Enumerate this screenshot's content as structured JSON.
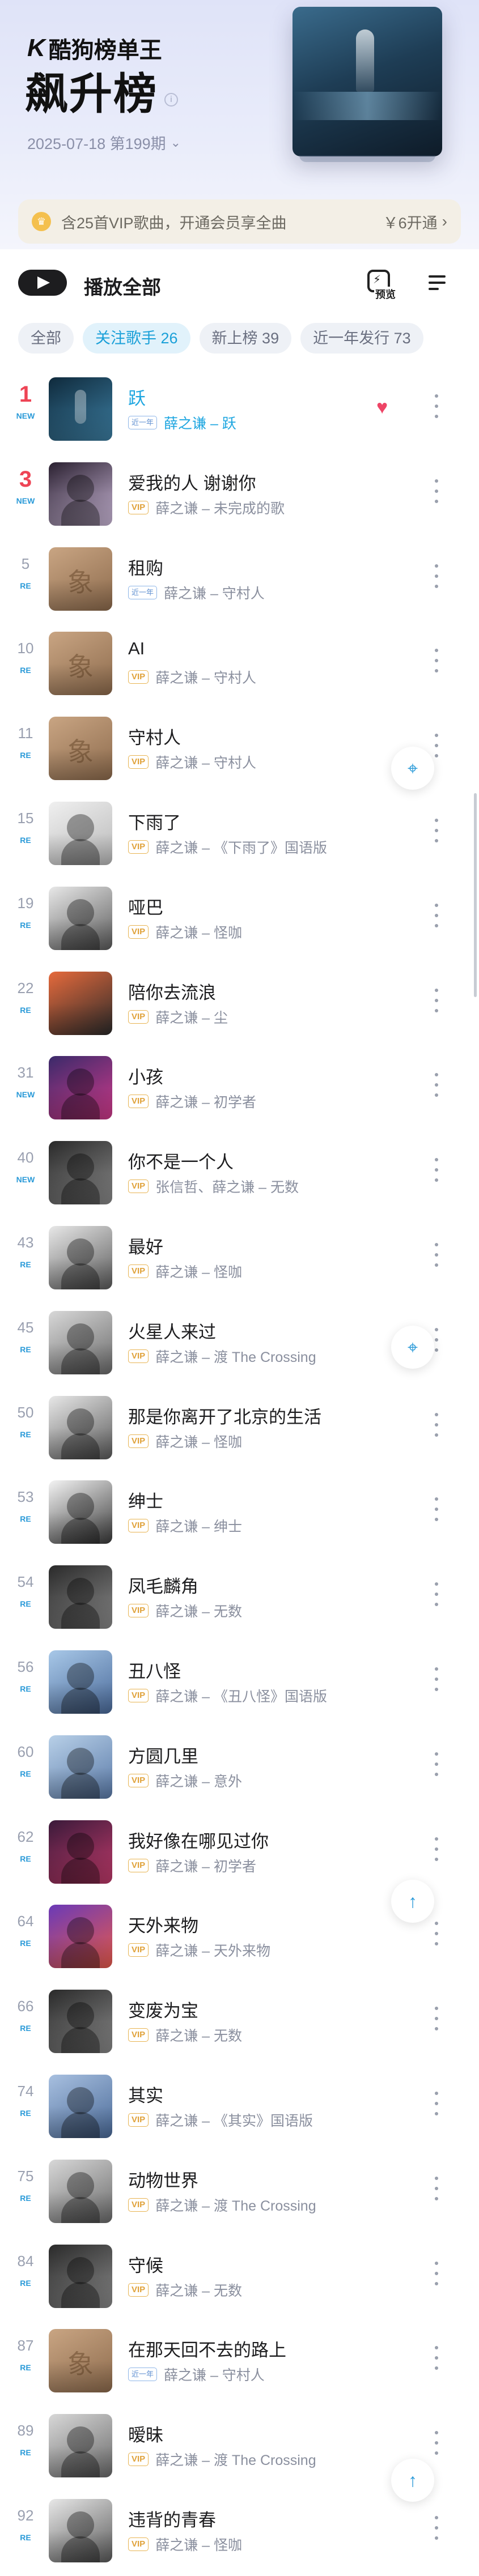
{
  "header": {
    "brand_mark": "K",
    "brand_name": "酷狗榜单王",
    "title": "飙升榜",
    "info_icon": "i",
    "period": "2025-07-18 第199期",
    "period_icon": "chevron-down-icon"
  },
  "vip_banner": {
    "text": "含25首VIP歌曲，开通会员享全曲",
    "price": "￥6开通",
    "icon": "crown-icon"
  },
  "actions": {
    "play_all": "播放全部",
    "preview": "预览"
  },
  "filters": [
    {
      "label": "全部",
      "active": false
    },
    {
      "label": "关注歌手 26",
      "active": true
    },
    {
      "label": "新上榜 39",
      "active": false
    },
    {
      "label": "近一年发行 73",
      "active": false
    }
  ],
  "songs": [
    {
      "rank": "1",
      "trend": "NEW",
      "title": "跃",
      "meta": "薛之谦 – 跃",
      "badge": "first",
      "badge_text": "近一年",
      "current": true,
      "liked": true,
      "art": [
        "#0f2a3c",
        "#3d7fa3"
      ],
      "art_kind": "wave"
    },
    {
      "rank": "3",
      "trend": "NEW",
      "title": "爱我的人 谢谢你",
      "meta": "薛之谦 – 未完成的歌",
      "badge": "vip",
      "badge_text": "VIP",
      "art": [
        "#2a2030",
        "#cbb8d8"
      ],
      "art_kind": "person"
    },
    {
      "rank": "5",
      "trend": "RE",
      "title": "租购",
      "meta": "薛之谦 – 守村人",
      "badge": "first",
      "badge_text": "近一年",
      "art": [
        "#c9a583",
        "#8c6a4c"
      ],
      "art_kind": "glyph"
    },
    {
      "rank": "10",
      "trend": "RE",
      "title": "AI",
      "meta": "薛之谦 – 守村人",
      "badge": "vip",
      "badge_text": "VIP",
      "art": [
        "#c9a583",
        "#8c6a4c"
      ],
      "art_kind": "glyph"
    },
    {
      "rank": "11",
      "trend": "RE",
      "title": "守村人",
      "meta": "薛之谦 – 守村人",
      "badge": "vip",
      "badge_text": "VIP",
      "art": [
        "#c9a583",
        "#8c6a4c"
      ],
      "art_kind": "glyph"
    },
    {
      "rank": "15",
      "trend": "RE",
      "title": "下雨了",
      "meta": "薛之谦 – 《下雨了》国语版",
      "badge": "vip",
      "badge_text": "VIP",
      "art": [
        "#f0f0f0",
        "#b8b8b8"
      ],
      "art_kind": "person"
    },
    {
      "rank": "19",
      "trend": "RE",
      "title": "哑巴",
      "meta": "薛之谦 – 怪咖",
      "badge": "vip",
      "badge_text": "VIP",
      "art": [
        "#e8e8e8",
        "#5a5a5a"
      ],
      "art_kind": "person"
    },
    {
      "rank": "22",
      "trend": "RE",
      "title": "陪你去流浪",
      "meta": "薛之谦 – 尘",
      "badge": "vip",
      "badge_text": "VIP",
      "art": [
        "#e66a3c",
        "#2a2a2a"
      ],
      "art_kind": "none"
    },
    {
      "rank": "31",
      "trend": "NEW",
      "title": "小孩",
      "meta": "薛之谦 – 初学者",
      "badge": "vip",
      "badge_text": "VIP",
      "art": [
        "#3a2a6a",
        "#d03a8a"
      ],
      "art_kind": "person"
    },
    {
      "rank": "40",
      "trend": "NEW",
      "title": "你不是一个人",
      "meta": "张信哲、薛之谦 – 无数",
      "badge": "vip",
      "badge_text": "VIP",
      "art": [
        "#2a2a2a",
        "#8a8a8a"
      ],
      "art_kind": "person"
    },
    {
      "rank": "43",
      "trend": "RE",
      "title": "最好",
      "meta": "薛之谦 – 怪咖",
      "badge": "vip",
      "badge_text": "VIP",
      "art": [
        "#e8e8e8",
        "#5a5a5a"
      ],
      "art_kind": "person"
    },
    {
      "rank": "45",
      "trend": "RE",
      "title": "火星人来过",
      "meta": "薛之谦 – 渡 The Crossing",
      "badge": "vip",
      "badge_text": "VIP",
      "art": [
        "#d8d8d8",
        "#6a6a6a"
      ],
      "art_kind": "person"
    },
    {
      "rank": "50",
      "trend": "RE",
      "title": "那是你离开了北京的生活",
      "meta": "薛之谦 – 怪咖",
      "badge": "vip",
      "badge_text": "VIP",
      "art": [
        "#e8e8e8",
        "#5a5a5a"
      ],
      "art_kind": "person"
    },
    {
      "rank": "53",
      "trend": "RE",
      "title": "绅士",
      "meta": "薛之谦 – 绅士",
      "badge": "vip",
      "badge_text": "VIP",
      "art": [
        "#f4f4f4",
        "#3a3a3a"
      ],
      "art_kind": "person"
    },
    {
      "rank": "54",
      "trend": "RE",
      "title": "凤毛麟角",
      "meta": "薛之谦 – 无数",
      "badge": "vip",
      "badge_text": "VIP",
      "art": [
        "#2a2a2a",
        "#8a8a8a"
      ],
      "art_kind": "person"
    },
    {
      "rank": "56",
      "trend": "RE",
      "title": "丑八怪",
      "meta": "薛之谦 – 《丑八怪》国语版",
      "badge": "vip",
      "badge_text": "VIP",
      "art": [
        "#a8c8e8",
        "#4a6a9a"
      ],
      "art_kind": "person"
    },
    {
      "rank": "60",
      "trend": "RE",
      "title": "方圆几里",
      "meta": "薛之谦 – 意外",
      "badge": "vip",
      "badge_text": "VIP",
      "art": [
        "#b8d0e8",
        "#5a7aa8"
      ],
      "art_kind": "person"
    },
    {
      "rank": "62",
      "trend": "RE",
      "title": "我好像在哪见过你",
      "meta": "薛之谦 – 初学者",
      "badge": "vip",
      "badge_text": "VIP",
      "art": [
        "#3a1a3a",
        "#c03a6a"
      ],
      "art_kind": "person"
    },
    {
      "rank": "64",
      "trend": "RE",
      "title": "天外来物",
      "meta": "薛之谦 – 天外来物",
      "badge": "vip",
      "badge_text": "VIP",
      "art": [
        "#6a3ab8",
        "#e85a4a"
      ],
      "art_kind": "person"
    },
    {
      "rank": "66",
      "trend": "RE",
      "title": "变废为宝",
      "meta": "薛之谦 – 无数",
      "badge": "vip",
      "badge_text": "VIP",
      "art": [
        "#2a2a2a",
        "#8a8a8a"
      ],
      "art_kind": "person"
    },
    {
      "rank": "74",
      "trend": "RE",
      "title": "其实",
      "meta": "薛之谦 – 《其实》国语版",
      "badge": "vip",
      "badge_text": "VIP",
      "art": [
        "#a8c0e0",
        "#4a6a98"
      ],
      "art_kind": "person"
    },
    {
      "rank": "75",
      "trend": "RE",
      "title": "动物世界",
      "meta": "薛之谦 – 渡 The Crossing",
      "badge": "vip",
      "badge_text": "VIP",
      "art": [
        "#d8d8d8",
        "#6a6a6a"
      ],
      "art_kind": "person"
    },
    {
      "rank": "84",
      "trend": "RE",
      "title": "守候",
      "meta": "薛之谦 – 无数",
      "badge": "vip",
      "badge_text": "VIP",
      "art": [
        "#2a2a2a",
        "#8a8a8a"
      ],
      "art_kind": "person"
    },
    {
      "rank": "87",
      "trend": "RE",
      "title": "在那天回不去的路上",
      "meta": "薛之谦 – 守村人",
      "badge": "first",
      "badge_text": "近一年",
      "art": [
        "#c9a583",
        "#8c6a4c"
      ],
      "art_kind": "glyph"
    },
    {
      "rank": "89",
      "trend": "RE",
      "title": "暧昧",
      "meta": "薛之谦 – 渡 The Crossing",
      "badge": "vip",
      "badge_text": "VIP",
      "art": [
        "#d8d8d8",
        "#6a6a6a"
      ],
      "art_kind": "person"
    },
    {
      "rank": "92",
      "trend": "RE",
      "title": "违背的青春",
      "meta": "薛之谦 – 怪咖",
      "badge": "vip",
      "badge_text": "VIP",
      "art": [
        "#e8e8e8",
        "#5a5a5a"
      ],
      "art_kind": "person"
    }
  ],
  "floating": {
    "locate_icon": "crosshair-icon",
    "top_icon": "arrow-up-icon"
  }
}
